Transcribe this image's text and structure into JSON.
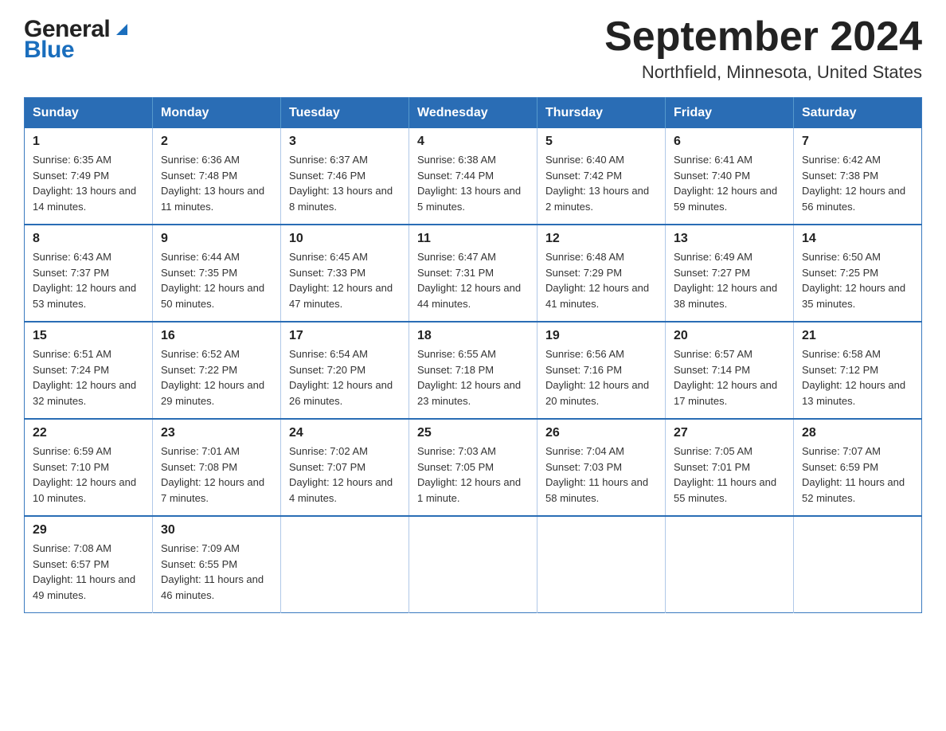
{
  "header": {
    "logo_general": "General",
    "logo_blue": "Blue",
    "title": "September 2024",
    "subtitle": "Northfield, Minnesota, United States"
  },
  "days_of_week": [
    "Sunday",
    "Monday",
    "Tuesday",
    "Wednesday",
    "Thursday",
    "Friday",
    "Saturday"
  ],
  "weeks": [
    [
      {
        "day": "1",
        "sunrise": "Sunrise: 6:35 AM",
        "sunset": "Sunset: 7:49 PM",
        "daylight": "Daylight: 13 hours and 14 minutes."
      },
      {
        "day": "2",
        "sunrise": "Sunrise: 6:36 AM",
        "sunset": "Sunset: 7:48 PM",
        "daylight": "Daylight: 13 hours and 11 minutes."
      },
      {
        "day": "3",
        "sunrise": "Sunrise: 6:37 AM",
        "sunset": "Sunset: 7:46 PM",
        "daylight": "Daylight: 13 hours and 8 minutes."
      },
      {
        "day": "4",
        "sunrise": "Sunrise: 6:38 AM",
        "sunset": "Sunset: 7:44 PM",
        "daylight": "Daylight: 13 hours and 5 minutes."
      },
      {
        "day": "5",
        "sunrise": "Sunrise: 6:40 AM",
        "sunset": "Sunset: 7:42 PM",
        "daylight": "Daylight: 13 hours and 2 minutes."
      },
      {
        "day": "6",
        "sunrise": "Sunrise: 6:41 AM",
        "sunset": "Sunset: 7:40 PM",
        "daylight": "Daylight: 12 hours and 59 minutes."
      },
      {
        "day": "7",
        "sunrise": "Sunrise: 6:42 AM",
        "sunset": "Sunset: 7:38 PM",
        "daylight": "Daylight: 12 hours and 56 minutes."
      }
    ],
    [
      {
        "day": "8",
        "sunrise": "Sunrise: 6:43 AM",
        "sunset": "Sunset: 7:37 PM",
        "daylight": "Daylight: 12 hours and 53 minutes."
      },
      {
        "day": "9",
        "sunrise": "Sunrise: 6:44 AM",
        "sunset": "Sunset: 7:35 PM",
        "daylight": "Daylight: 12 hours and 50 minutes."
      },
      {
        "day": "10",
        "sunrise": "Sunrise: 6:45 AM",
        "sunset": "Sunset: 7:33 PM",
        "daylight": "Daylight: 12 hours and 47 minutes."
      },
      {
        "day": "11",
        "sunrise": "Sunrise: 6:47 AM",
        "sunset": "Sunset: 7:31 PM",
        "daylight": "Daylight: 12 hours and 44 minutes."
      },
      {
        "day": "12",
        "sunrise": "Sunrise: 6:48 AM",
        "sunset": "Sunset: 7:29 PM",
        "daylight": "Daylight: 12 hours and 41 minutes."
      },
      {
        "day": "13",
        "sunrise": "Sunrise: 6:49 AM",
        "sunset": "Sunset: 7:27 PM",
        "daylight": "Daylight: 12 hours and 38 minutes."
      },
      {
        "day": "14",
        "sunrise": "Sunrise: 6:50 AM",
        "sunset": "Sunset: 7:25 PM",
        "daylight": "Daylight: 12 hours and 35 minutes."
      }
    ],
    [
      {
        "day": "15",
        "sunrise": "Sunrise: 6:51 AM",
        "sunset": "Sunset: 7:24 PM",
        "daylight": "Daylight: 12 hours and 32 minutes."
      },
      {
        "day": "16",
        "sunrise": "Sunrise: 6:52 AM",
        "sunset": "Sunset: 7:22 PM",
        "daylight": "Daylight: 12 hours and 29 minutes."
      },
      {
        "day": "17",
        "sunrise": "Sunrise: 6:54 AM",
        "sunset": "Sunset: 7:20 PM",
        "daylight": "Daylight: 12 hours and 26 minutes."
      },
      {
        "day": "18",
        "sunrise": "Sunrise: 6:55 AM",
        "sunset": "Sunset: 7:18 PM",
        "daylight": "Daylight: 12 hours and 23 minutes."
      },
      {
        "day": "19",
        "sunrise": "Sunrise: 6:56 AM",
        "sunset": "Sunset: 7:16 PM",
        "daylight": "Daylight: 12 hours and 20 minutes."
      },
      {
        "day": "20",
        "sunrise": "Sunrise: 6:57 AM",
        "sunset": "Sunset: 7:14 PM",
        "daylight": "Daylight: 12 hours and 17 minutes."
      },
      {
        "day": "21",
        "sunrise": "Sunrise: 6:58 AM",
        "sunset": "Sunset: 7:12 PM",
        "daylight": "Daylight: 12 hours and 13 minutes."
      }
    ],
    [
      {
        "day": "22",
        "sunrise": "Sunrise: 6:59 AM",
        "sunset": "Sunset: 7:10 PM",
        "daylight": "Daylight: 12 hours and 10 minutes."
      },
      {
        "day": "23",
        "sunrise": "Sunrise: 7:01 AM",
        "sunset": "Sunset: 7:08 PM",
        "daylight": "Daylight: 12 hours and 7 minutes."
      },
      {
        "day": "24",
        "sunrise": "Sunrise: 7:02 AM",
        "sunset": "Sunset: 7:07 PM",
        "daylight": "Daylight: 12 hours and 4 minutes."
      },
      {
        "day": "25",
        "sunrise": "Sunrise: 7:03 AM",
        "sunset": "Sunset: 7:05 PM",
        "daylight": "Daylight: 12 hours and 1 minute."
      },
      {
        "day": "26",
        "sunrise": "Sunrise: 7:04 AM",
        "sunset": "Sunset: 7:03 PM",
        "daylight": "Daylight: 11 hours and 58 minutes."
      },
      {
        "day": "27",
        "sunrise": "Sunrise: 7:05 AM",
        "sunset": "Sunset: 7:01 PM",
        "daylight": "Daylight: 11 hours and 55 minutes."
      },
      {
        "day": "28",
        "sunrise": "Sunrise: 7:07 AM",
        "sunset": "Sunset: 6:59 PM",
        "daylight": "Daylight: 11 hours and 52 minutes."
      }
    ],
    [
      {
        "day": "29",
        "sunrise": "Sunrise: 7:08 AM",
        "sunset": "Sunset: 6:57 PM",
        "daylight": "Daylight: 11 hours and 49 minutes."
      },
      {
        "day": "30",
        "sunrise": "Sunrise: 7:09 AM",
        "sunset": "Sunset: 6:55 PM",
        "daylight": "Daylight: 11 hours and 46 minutes."
      },
      null,
      null,
      null,
      null,
      null
    ]
  ]
}
